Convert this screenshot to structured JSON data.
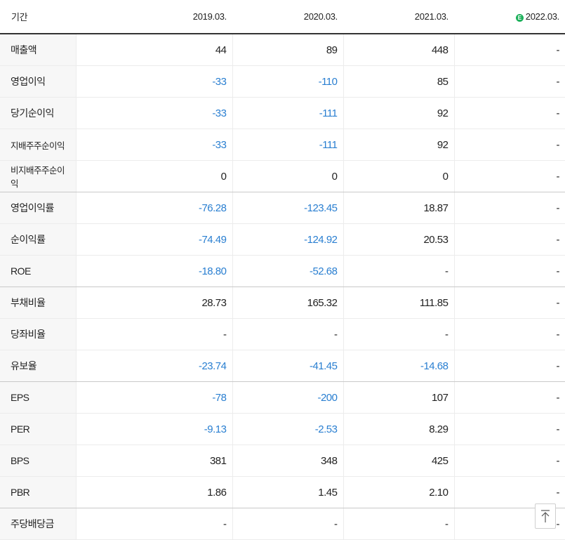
{
  "header": {
    "label": "기간",
    "years": [
      "2019.03.",
      "2020.03.",
      "2021.03.",
      "2022.03."
    ],
    "estimate_badge": "E"
  },
  "rows": [
    {
      "label": "매출액",
      "values": [
        "44",
        "89",
        "448",
        "-"
      ]
    },
    {
      "label": "영업이익",
      "values": [
        "-33",
        "-110",
        "85",
        "-"
      ]
    },
    {
      "label": "당기순이익",
      "values": [
        "-33",
        "-111",
        "92",
        "-"
      ]
    },
    {
      "label": "지배주주순이익",
      "values": [
        "-33",
        "-111",
        "92",
        "-"
      ]
    },
    {
      "label": "비지배주주순이익",
      "values": [
        "0",
        "0",
        "0",
        "-"
      ]
    },
    {
      "label": "영업이익률",
      "values": [
        "-76.28",
        "-123.45",
        "18.87",
        "-"
      ]
    },
    {
      "label": "순이익률",
      "values": [
        "-74.49",
        "-124.92",
        "20.53",
        "-"
      ]
    },
    {
      "label": "ROE",
      "values": [
        "-18.80",
        "-52.68",
        "-",
        "-"
      ]
    },
    {
      "label": "부채비율",
      "values": [
        "28.73",
        "165.32",
        "111.85",
        "-"
      ]
    },
    {
      "label": "당좌비율",
      "values": [
        "-",
        "-",
        "-",
        "-"
      ]
    },
    {
      "label": "유보율",
      "values": [
        "-23.74",
        "-41.45",
        "-14.68",
        "-"
      ]
    },
    {
      "label": "EPS",
      "values": [
        "-78",
        "-200",
        "107",
        "-"
      ]
    },
    {
      "label": "PER",
      "values": [
        "-9.13",
        "-2.53",
        "8.29",
        "-"
      ]
    },
    {
      "label": "BPS",
      "values": [
        "381",
        "348",
        "425",
        "-"
      ]
    },
    {
      "label": "PBR",
      "values": [
        "1.86",
        "1.45",
        "2.10",
        "-"
      ]
    },
    {
      "label": "주당배당금",
      "values": [
        "-",
        "-",
        "-",
        "-"
      ]
    }
  ],
  "colors": {
    "negative": "#2a7fd1",
    "estimate": "#1cb05a"
  }
}
